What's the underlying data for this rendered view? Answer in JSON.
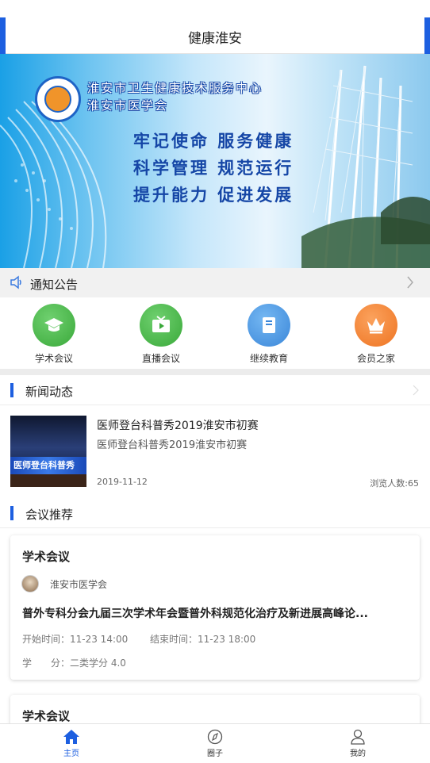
{
  "header": {
    "title": "健康淮安"
  },
  "banner": {
    "org_line1": "淮安市卫生健康技术服务中心",
    "org_line2": "淮安市医学会",
    "slogans": [
      "牢记使命  服务健康",
      "科学管理  规范运行",
      "提升能力  促进发展"
    ]
  },
  "notice": {
    "label": "通知公告",
    "icon": "speaker-icon"
  },
  "quick_links": [
    {
      "label": "学术会议",
      "icon": "graduation-cap-icon",
      "color": "#3aa93a"
    },
    {
      "label": "直播会议",
      "icon": "tv-play-icon",
      "color": "#3aa93a"
    },
    {
      "label": "继续教育",
      "icon": "book-icon",
      "color": "#3b87d9"
    },
    {
      "label": "会员之家",
      "icon": "crown-icon",
      "color": "#ee7422"
    }
  ],
  "news_section": {
    "title": "新闻动态",
    "items": [
      {
        "thumb_text": "医师登台科普秀",
        "title": "医师登台科普秀2019淮安市初赛",
        "subtitle": "医师登台科普秀2019淮安市初赛",
        "date": "2019-11-12",
        "views": "浏览人数:65"
      }
    ]
  },
  "meeting_section": {
    "title": "会议推荐",
    "cards": [
      {
        "type": "学术会议",
        "org": "淮安市医学会",
        "title": "普外专科分会九届三次学术年会暨普外科规范化治疗及新进展高峰论...",
        "start": "开始时间：11-23 14:00",
        "end": "结束时间：11-23 18:00",
        "credit": "学　　分：二类学分 4.0"
      },
      {
        "type": "学术会议"
      }
    ]
  },
  "tabbar": [
    {
      "label": "主页",
      "icon": "home-icon",
      "active": true
    },
    {
      "label": "圈子",
      "icon": "compass-icon",
      "active": false
    },
    {
      "label": "我的",
      "icon": "user-icon",
      "active": false
    }
  ],
  "colors": {
    "accent": "#1d5fe0",
    "notice_bg": "#f1f1f1"
  }
}
